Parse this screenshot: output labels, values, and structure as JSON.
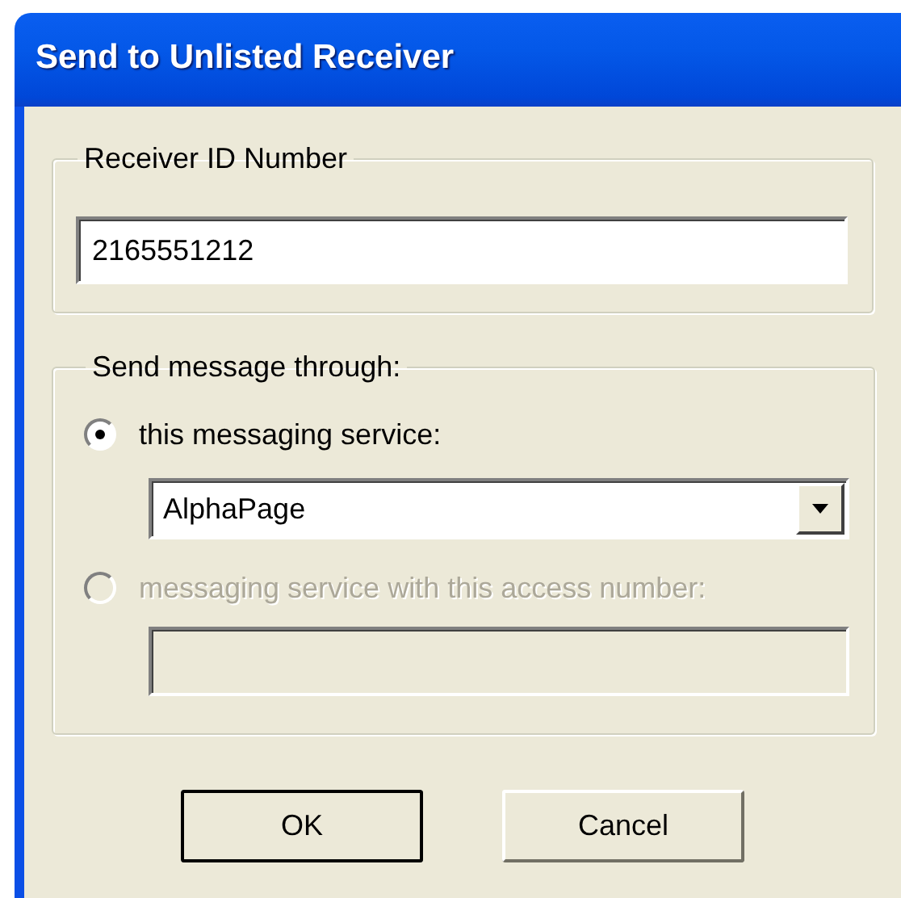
{
  "window": {
    "title": "Send to Unlisted Receiver"
  },
  "receiver_group": {
    "label": "Receiver ID Number",
    "value": "2165551212"
  },
  "send_group": {
    "label": "Send message through:",
    "options": [
      {
        "label": "this messaging service:",
        "selected": true,
        "disabled": false,
        "kind": "dropdown",
        "value": "AlphaPage"
      },
      {
        "label": "messaging service with this access number:",
        "selected": false,
        "disabled": true,
        "kind": "field"
      }
    ]
  },
  "buttons": [
    {
      "label": "OK",
      "default": true
    },
    {
      "label": "Cancel",
      "default": false
    }
  ]
}
